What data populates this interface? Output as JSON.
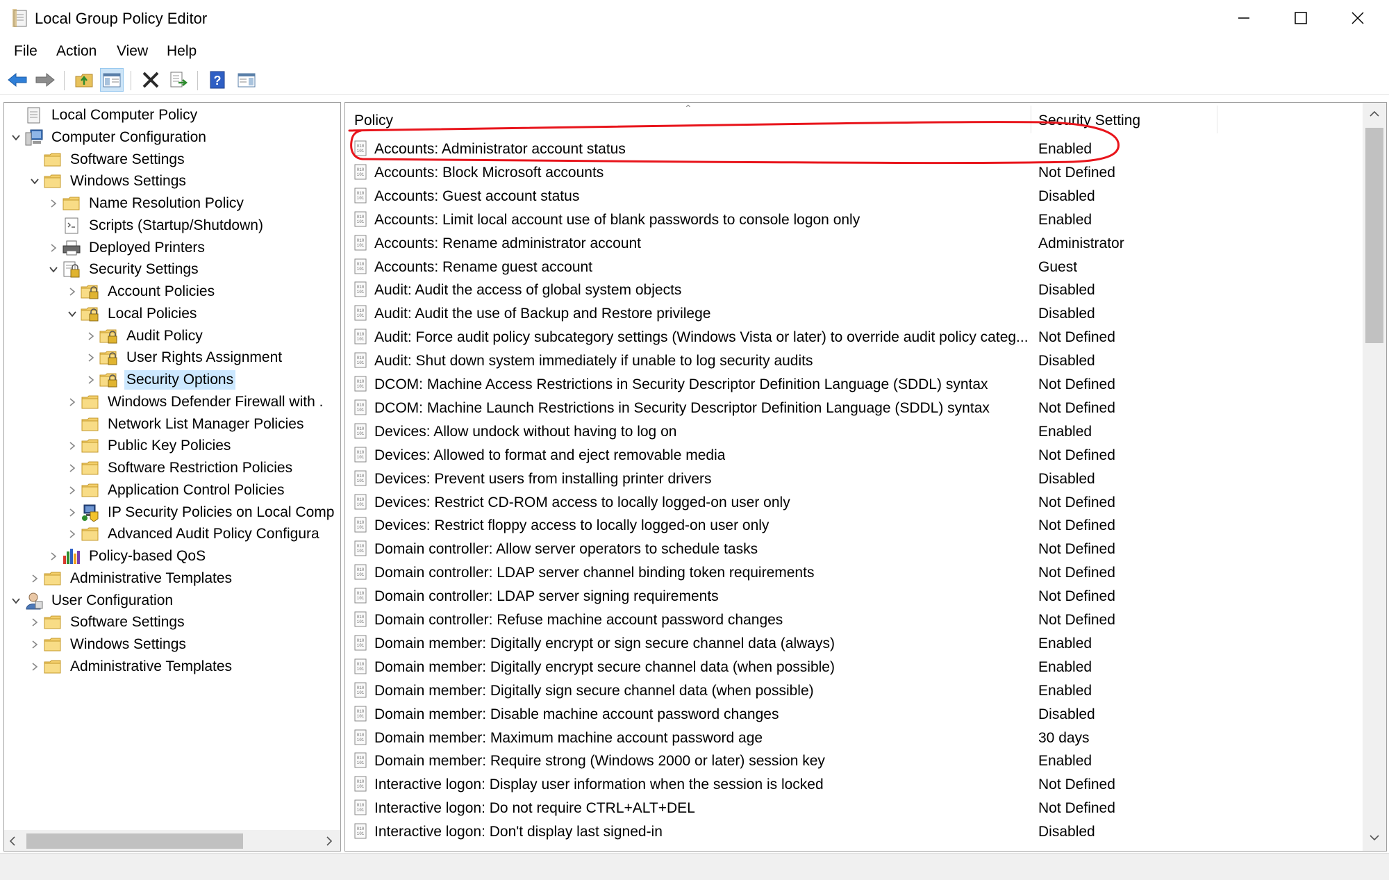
{
  "window": {
    "title": "Local Group Policy Editor",
    "icon": "policy-editor-icon"
  },
  "menu": [
    "File",
    "Action",
    "View",
    "Help"
  ],
  "toolbar": [
    "back-arrow-icon",
    "forward-arrow-icon",
    "up-folder-icon",
    "show-hide-tree-icon",
    "delete-icon",
    "export-list-icon",
    "help-icon",
    "properties-pane-icon"
  ],
  "tree": [
    {
      "label": "Local Computer Policy",
      "indent": 0,
      "icon": "policy-doc-icon",
      "expander": "none"
    },
    {
      "label": "Computer Configuration",
      "indent": 0,
      "icon": "computer-icon",
      "expander": "expanded"
    },
    {
      "label": "Software Settings",
      "indent": 1,
      "icon": "folder-icon",
      "expander": "none"
    },
    {
      "label": "Windows Settings",
      "indent": 1,
      "icon": "folder-icon",
      "expander": "expanded"
    },
    {
      "label": "Name Resolution Policy",
      "indent": 2,
      "icon": "folder-icon",
      "expander": "collapsed"
    },
    {
      "label": "Scripts (Startup/Shutdown)",
      "indent": 2,
      "icon": "scripts-icon",
      "expander": "none"
    },
    {
      "label": "Deployed Printers",
      "indent": 2,
      "icon": "printer-icon",
      "expander": "collapsed"
    },
    {
      "label": "Security Settings",
      "indent": 2,
      "icon": "security-settings-icon",
      "expander": "expanded"
    },
    {
      "label": "Account Policies",
      "indent": 3,
      "icon": "lock-folder-icon",
      "expander": "collapsed"
    },
    {
      "label": "Local Policies",
      "indent": 3,
      "icon": "lock-folder-icon",
      "expander": "expanded"
    },
    {
      "label": "Audit Policy",
      "indent": 4,
      "icon": "lock-folder-icon",
      "expander": "collapsed"
    },
    {
      "label": "User Rights Assignment",
      "indent": 4,
      "icon": "lock-folder-icon",
      "expander": "collapsed"
    },
    {
      "label": "Security Options",
      "indent": 4,
      "icon": "lock-folder-icon",
      "expander": "collapsed",
      "selected": true
    },
    {
      "label": "Windows Defender Firewall with .",
      "indent": 3,
      "icon": "folder-icon",
      "expander": "collapsed"
    },
    {
      "label": "Network List Manager Policies",
      "indent": 3,
      "icon": "folder-icon",
      "expander": "none"
    },
    {
      "label": "Public Key Policies",
      "indent": 3,
      "icon": "folder-icon",
      "expander": "collapsed"
    },
    {
      "label": "Software Restriction Policies",
      "indent": 3,
      "icon": "folder-icon",
      "expander": "collapsed"
    },
    {
      "label": "Application Control Policies",
      "indent": 3,
      "icon": "folder-icon",
      "expander": "collapsed"
    },
    {
      "label": "IP Security Policies on Local Comp",
      "indent": 3,
      "icon": "ip-security-icon",
      "expander": "collapsed"
    },
    {
      "label": "Advanced Audit Policy Configura",
      "indent": 3,
      "icon": "folder-icon",
      "expander": "collapsed"
    },
    {
      "label": "Policy-based QoS",
      "indent": 2,
      "icon": "qos-chart-icon",
      "expander": "collapsed"
    },
    {
      "label": "Administrative Templates",
      "indent": 1,
      "icon": "folder-icon",
      "expander": "collapsed"
    },
    {
      "label": "User Configuration",
      "indent": 0,
      "icon": "user-icon",
      "expander": "expanded"
    },
    {
      "label": "Software Settings",
      "indent": 1,
      "icon": "folder-icon",
      "expander": "collapsed"
    },
    {
      "label": "Windows Settings",
      "indent": 1,
      "icon": "folder-icon",
      "expander": "collapsed"
    },
    {
      "label": "Administrative Templates",
      "indent": 1,
      "icon": "folder-icon",
      "expander": "collapsed"
    }
  ],
  "list": {
    "columns": {
      "policy": "Policy",
      "setting": "Security Setting"
    },
    "rows": [
      {
        "policy": "Accounts: Administrator account status",
        "setting": "Enabled"
      },
      {
        "policy": "Accounts: Block Microsoft accounts",
        "setting": "Not Defined"
      },
      {
        "policy": "Accounts: Guest account status",
        "setting": "Disabled"
      },
      {
        "policy": "Accounts: Limit local account use of blank passwords to console logon only",
        "setting": "Enabled"
      },
      {
        "policy": "Accounts: Rename administrator account",
        "setting": "Administrator"
      },
      {
        "policy": "Accounts: Rename guest account",
        "setting": "Guest"
      },
      {
        "policy": "Audit: Audit the access of global system objects",
        "setting": "Disabled"
      },
      {
        "policy": "Audit: Audit the use of Backup and Restore privilege",
        "setting": "Disabled"
      },
      {
        "policy": "Audit: Force audit policy subcategory settings (Windows Vista or later) to override audit policy categ...",
        "setting": "Not Defined"
      },
      {
        "policy": "Audit: Shut down system immediately if unable to log security audits",
        "setting": "Disabled"
      },
      {
        "policy": "DCOM: Machine Access Restrictions in Security Descriptor Definition Language (SDDL) syntax",
        "setting": "Not Defined"
      },
      {
        "policy": "DCOM: Machine Launch Restrictions in Security Descriptor Definition Language (SDDL) syntax",
        "setting": "Not Defined"
      },
      {
        "policy": "Devices: Allow undock without having to log on",
        "setting": "Enabled"
      },
      {
        "policy": "Devices: Allowed to format and eject removable media",
        "setting": "Not Defined"
      },
      {
        "policy": "Devices: Prevent users from installing printer drivers",
        "setting": "Disabled"
      },
      {
        "policy": "Devices: Restrict CD-ROM access to locally logged-on user only",
        "setting": "Not Defined"
      },
      {
        "policy": "Devices: Restrict floppy access to locally logged-on user only",
        "setting": "Not Defined"
      },
      {
        "policy": "Domain controller: Allow server operators to schedule tasks",
        "setting": "Not Defined"
      },
      {
        "policy": "Domain controller: LDAP server channel binding token requirements",
        "setting": "Not Defined"
      },
      {
        "policy": "Domain controller: LDAP server signing requirements",
        "setting": "Not Defined"
      },
      {
        "policy": "Domain controller: Refuse machine account password changes",
        "setting": "Not Defined"
      },
      {
        "policy": "Domain member: Digitally encrypt or sign secure channel data (always)",
        "setting": "Enabled"
      },
      {
        "policy": "Domain member: Digitally encrypt secure channel data (when possible)",
        "setting": "Enabled"
      },
      {
        "policy": "Domain member: Digitally sign secure channel data (when possible)",
        "setting": "Enabled"
      },
      {
        "policy": "Domain member: Disable machine account password changes",
        "setting": "Disabled"
      },
      {
        "policy": "Domain member: Maximum machine account password age",
        "setting": "30 days"
      },
      {
        "policy": "Domain member: Require strong (Windows 2000 or later) session key",
        "setting": "Enabled"
      },
      {
        "policy": "Interactive logon: Display user information when the session is locked",
        "setting": "Not Defined"
      },
      {
        "policy": "Interactive logon: Do not require CTRL+ALT+DEL",
        "setting": "Not Defined"
      },
      {
        "policy": "Interactive logon: Don't display last signed-in",
        "setting": "Disabled"
      }
    ]
  },
  "highlight": {
    "color": "#e8141b",
    "row_index": 0
  },
  "colors": {
    "selection": "#cce8ff",
    "pressed_button": "#cce4f7"
  }
}
